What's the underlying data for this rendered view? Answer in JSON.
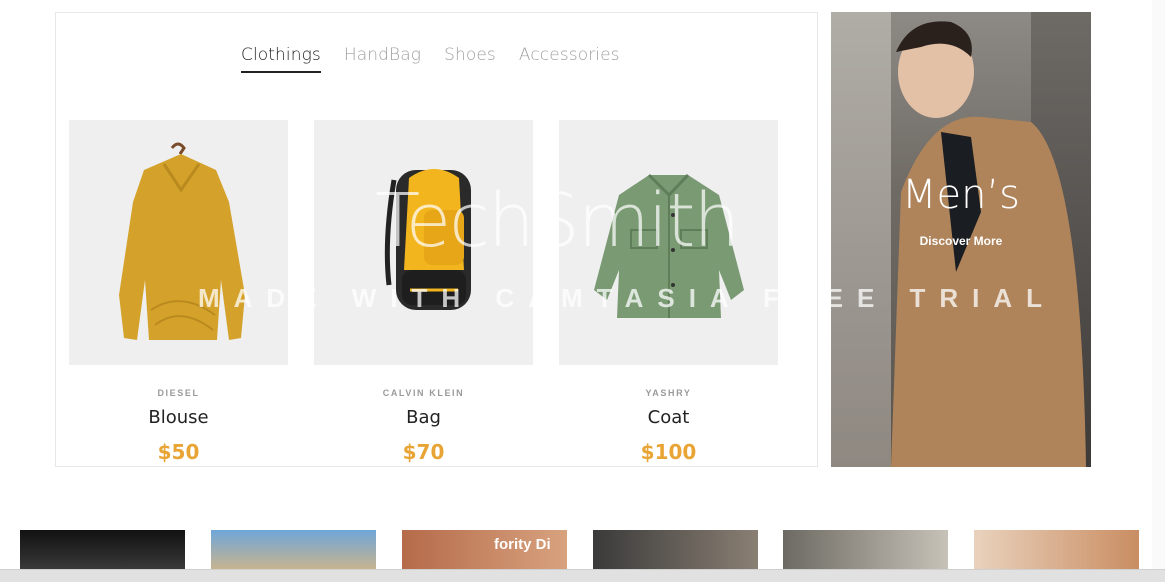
{
  "tabs": [
    {
      "label": "Clothings"
    },
    {
      "label": "HandBag"
    },
    {
      "label": "Shoes"
    },
    {
      "label": "Accessories"
    }
  ],
  "products": [
    {
      "brand": "DIESEL",
      "name": "Blouse",
      "price": "$50"
    },
    {
      "brand": "CALVIN KLEIN",
      "name": "Bag",
      "price": "$70"
    },
    {
      "brand": "YASHRY",
      "name": "Coat",
      "price": "$100"
    }
  ],
  "hero": {
    "title": "Men’s",
    "link": "Discover More"
  },
  "watermark": {
    "brand": "TechSmith",
    "trial": "MADE WITH CAMTASIA FREE TRIAL"
  },
  "thumbnail_text": "fority Di",
  "colors": {
    "accent": "#e8a434",
    "sweater": "#d4a22a",
    "coat": "#7a9a73"
  }
}
